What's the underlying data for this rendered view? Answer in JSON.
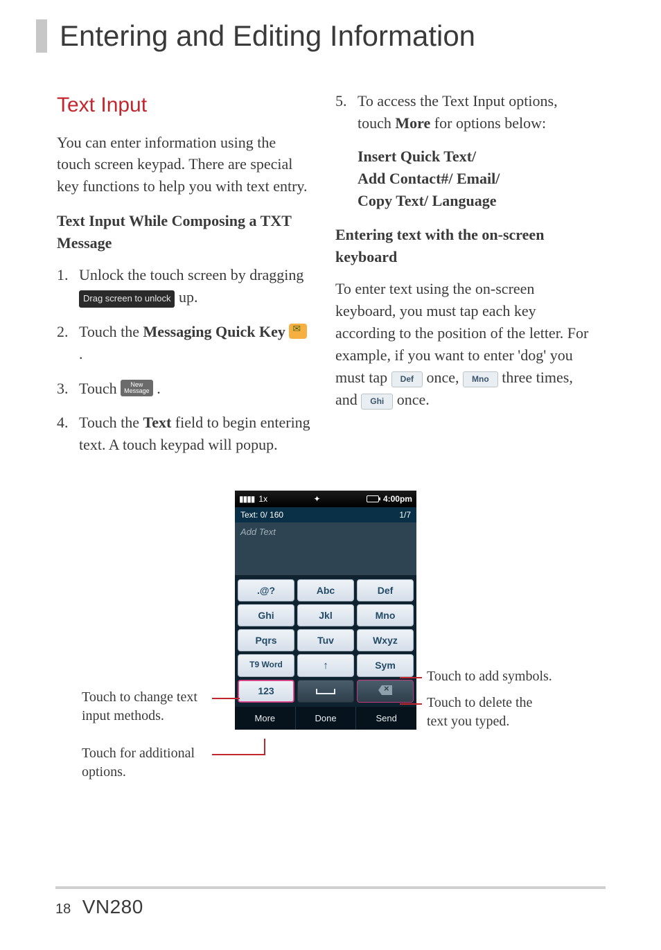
{
  "page": {
    "title": "Entering and Editing Information",
    "number": "18",
    "model": "VN280"
  },
  "left": {
    "heading": "Text Input",
    "intro": "You can enter information using the touch screen keypad. There are special key functions to help you with text entry.",
    "subhead": "Text Input While Composing a TXT Message",
    "steps": {
      "s1a": "Unlock the touch screen by dragging ",
      "s1chip": "Drag screen to unlock",
      "s1b": " up.",
      "s2a": "Touch the ",
      "s2b": "Messaging Quick Key",
      "s2c": ".",
      "s3a": "Touch ",
      "s3chip1": "New",
      "s3chip2": "Message",
      "s3b": ".",
      "s4a": "Touch the ",
      "s4b": "Text",
      "s4c": " field to begin entering text. A touch keypad will popup."
    }
  },
  "right": {
    "s5a": "To access the Text Input options, touch ",
    "s5b": "More",
    "s5c": " for options below:",
    "opts1": "Insert Quick Text/",
    "opts2": "Add Contact#/ Email/",
    "opts3": "Copy Text/ Language",
    "subhead": "Entering text with the on-screen keyboard",
    "p1": "To enter text using the on-screen keyboard, you must tap each key according to the position of the letter. For example, if you want to enter 'dog' you must tap ",
    "k1": "Def",
    "p2": " once, ",
    "k2": "Mno",
    "p3": " three times, and ",
    "k3": "Ghi",
    "p4": " once."
  },
  "phone": {
    "status": {
      "signal": "1x",
      "time": "4:00pm",
      "loc": "✦"
    },
    "textinfo": {
      "left": "Text: 0/ 160",
      "right": "1/7"
    },
    "placeholder": "Add Text",
    "keys": {
      "r1": {
        "a": ".@?",
        "b": "Abc",
        "c": "Def"
      },
      "r2": {
        "a": "Ghi",
        "b": "Jkl",
        "c": "Mno"
      },
      "r3": {
        "a": "Pqrs",
        "b": "Tuv",
        "c": "Wxyz"
      },
      "r4": {
        "a": "T9 Word",
        "b_arrow": "↑",
        "c": "Sym"
      },
      "r5": {
        "a": "123"
      }
    },
    "bottom": {
      "a": "More",
      "b": "Done",
      "c": "Send"
    }
  },
  "callouts": {
    "sym": "Touch to add symbols.",
    "del1": "Touch to delete the",
    "del2": "text you typed.",
    "mode1": "Touch to change text",
    "mode2": "input methods.",
    "more1": "Touch for additional",
    "more2": "options."
  }
}
